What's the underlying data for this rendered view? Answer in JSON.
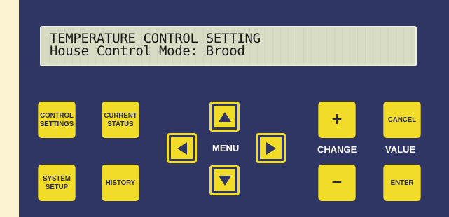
{
  "display": {
    "line1": "TEMPERATURE CONTROL SETTING",
    "line2": "House Control Mode: Brood"
  },
  "buttons": {
    "control_settings": "CONTROL\nSETTINGS",
    "current_status": "CURRENT\nSTATUS",
    "system_setup": "SYSTEM\nSETUP",
    "history": "HISTORY",
    "plus": "+",
    "minus": "−",
    "cancel": "CANCEL",
    "enter": "ENTER"
  },
  "labels": {
    "menu": "MENU",
    "change": "CHANGE",
    "value": "VALUE"
  },
  "colors": {
    "panel": "#303663",
    "button": "#f2dc2a",
    "lcd": "#d9dcc4"
  }
}
